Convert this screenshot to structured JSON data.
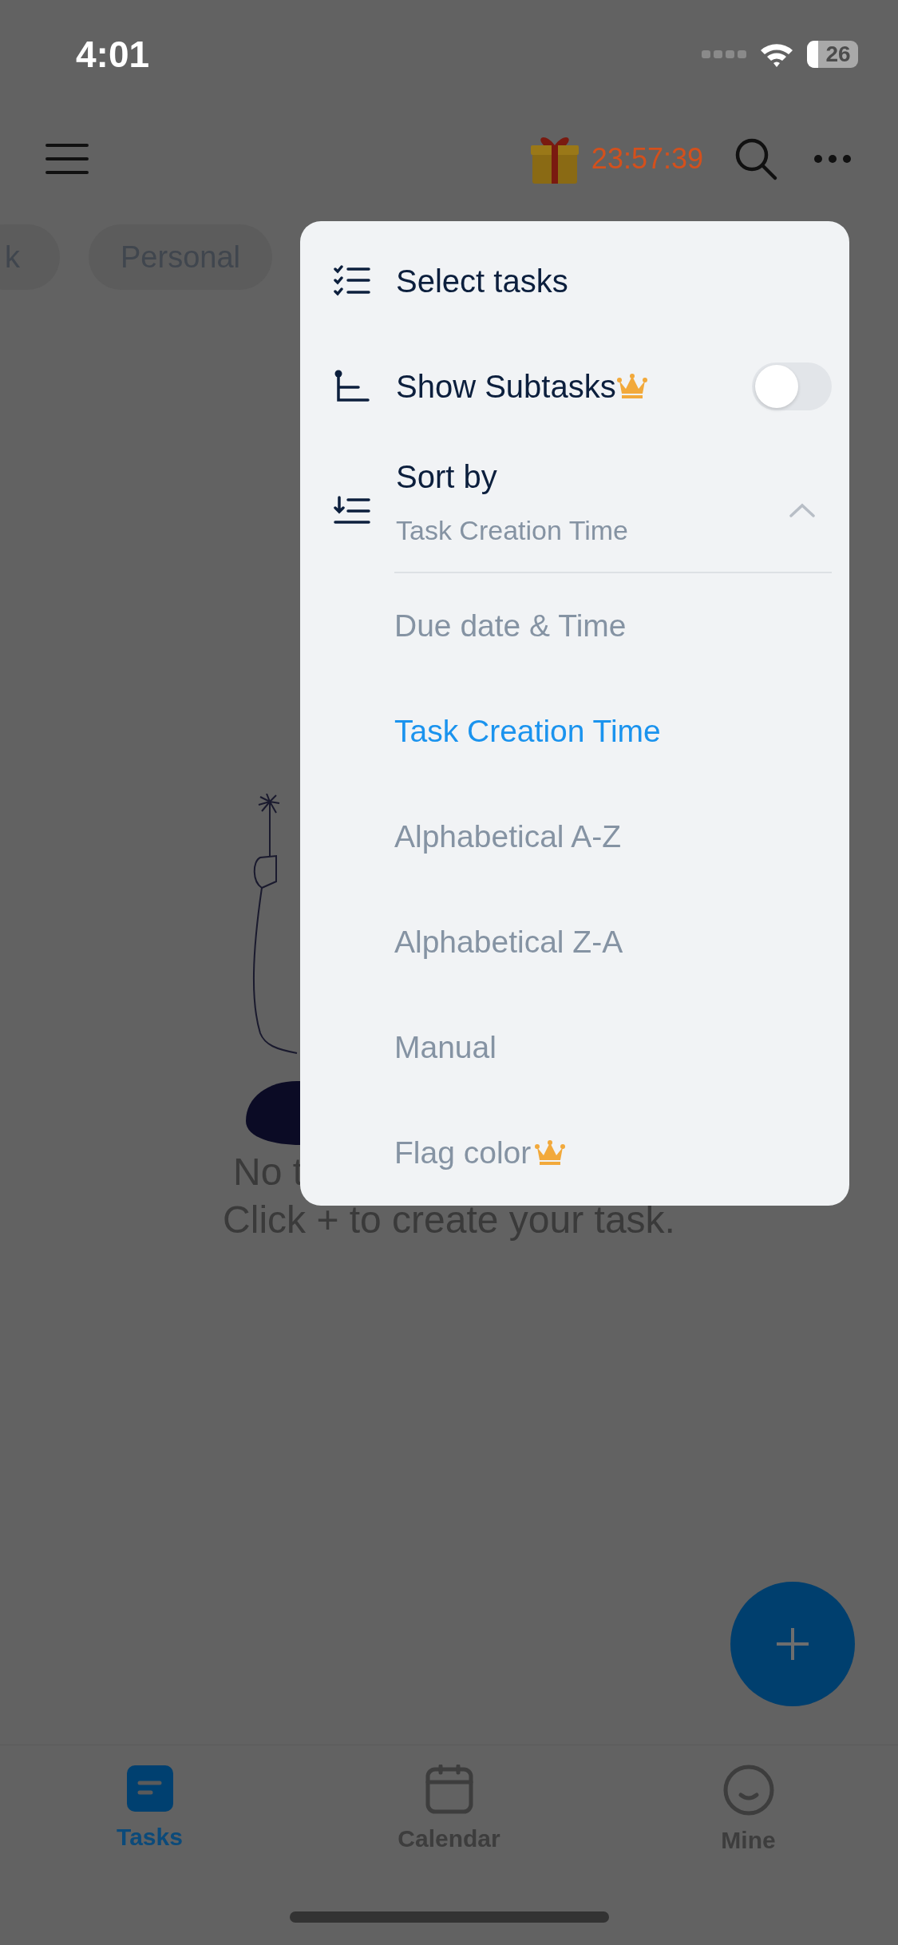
{
  "status_bar": {
    "time": "4:01",
    "battery": "26"
  },
  "toolbar": {
    "timer": "23:57:39"
  },
  "categories": [
    {
      "label": "k"
    },
    {
      "label": "Personal"
    }
  ],
  "empty_state": {
    "line_1": "No t",
    "line_2": "Click + to create your task."
  },
  "menu": {
    "items": [
      {
        "kind": "action",
        "label": "Select tasks"
      },
      {
        "kind": "toggle",
        "label": "Show Subtasks",
        "premium": true,
        "on": false
      },
      {
        "kind": "sort",
        "label": "Sort by",
        "value": "Task Creation Time",
        "expanded": true
      }
    ],
    "sort_options": [
      {
        "label": "Due date & Time",
        "selected": false,
        "premium": false
      },
      {
        "label": "Task Creation Time",
        "selected": true,
        "premium": false
      },
      {
        "label": "Alphabetical A-Z",
        "selected": false,
        "premium": false
      },
      {
        "label": "Alphabetical Z-A",
        "selected": false,
        "premium": false
      },
      {
        "label": "Manual",
        "selected": false,
        "premium": false
      },
      {
        "label": "Flag color",
        "selected": false,
        "premium": true
      }
    ]
  },
  "tab_bar": [
    {
      "label": "Tasks",
      "selected": true
    },
    {
      "label": "Calendar",
      "selected": false
    },
    {
      "label": "Mine",
      "selected": false
    }
  ]
}
